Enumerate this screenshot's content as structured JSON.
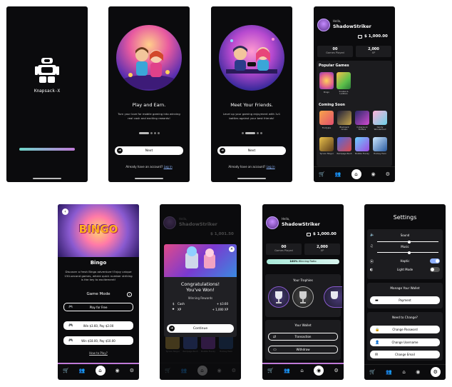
{
  "splash": {
    "brand": "Knapsack-X"
  },
  "onboard1": {
    "title": "Play and Earn.",
    "body": "Turn your love for mobile gaming into winning real cash and exciting rewards!",
    "next_label": "Next",
    "login_prompt": "Already have an account?",
    "login_link": "Log in"
  },
  "onboard2": {
    "title": "Meet Your Friends.",
    "body": "Level up your gaming enjoyment with 1v1 battles against your best friends!",
    "next_label": "Next",
    "login_prompt": "Already have an account?",
    "login_link": "Log in"
  },
  "home": {
    "greeting": "Hello,",
    "username": "ShadowStriker",
    "balance": "$ 1,000.00",
    "games_played_value": "00",
    "games_played_label": "Games Played",
    "xp_value": "2,000",
    "xp_label": "XP",
    "popular_title": "Popular Games",
    "popular": [
      "Bingo",
      "Snakes & Ladders"
    ],
    "coming_title": "Coming Soon",
    "coming": [
      "Fruityple",
      "Blackjack Crown",
      "Cyberpunk Drifters",
      "Candy Wonderland",
      "Tycoon Mogul",
      "Rampage Rush",
      "Bubble Frenzy",
      "Hockey Hero"
    ]
  },
  "bingo": {
    "logo_text": "BINGO",
    "title": "Bingo",
    "body": "Discover a fresh Bingo adventure! Enjoy unique 150-second games, where quick number striking is the key to excitement!",
    "mode_title": "Game Mode",
    "info_glyph": "i",
    "free_label": "Play for Free",
    "paid1_label": "Win $3.60, Pay $2.00",
    "paid2_label": "Win $18.00, Pay $10.00",
    "howto_label": "How to Play?"
  },
  "win": {
    "greeting": "Hello,",
    "username": "ShadowStriker",
    "balance": "$ 1,001.50",
    "title_line1": "Congratulations!",
    "title_line2": "You've Won!",
    "rewards_title": "Winning Rewards",
    "cash_label": "Cash",
    "cash_value": "+ $3.60",
    "xp_label": "XP",
    "xp_value": "+ 1,000 XP",
    "continue_label": "Continue",
    "bg_tiles": [
      "Tycoon Mogul",
      "Rampage Rush",
      "Bubble Frenzy",
      "Hockey Hero"
    ]
  },
  "profile": {
    "greeting": "Hello,",
    "username": "ShadowStriker",
    "balance": "$ 1,000.00",
    "games_played_value": "00",
    "games_played_label": "Games Played",
    "xp_value": "2,000",
    "xp_label": "XP",
    "win_ratio_value": "100%",
    "win_ratio_label": "Winning Ratio",
    "trophies_title": "Your Trophies",
    "wallet_title": "Your Wallet",
    "transaction_label": "Transaction",
    "withdraw_label": "Withdraw"
  },
  "settings": {
    "title": "Settings",
    "sound_label": "Sound",
    "music_label": "Music",
    "haptic_label": "Haptic",
    "light_label": "Light Mode",
    "sound_level": 0.52,
    "music_level": 0.52,
    "haptic_on": true,
    "light_on": false,
    "wallet_title": "Manage Your Wallet",
    "payment_label": "Payment",
    "change_title": "Need to Change?",
    "change_password": "Change Password",
    "change_username": "Change Username",
    "change_email": "Change Email"
  },
  "nav": {
    "icons": [
      "cart-icon",
      "friends-icon",
      "home-icon",
      "profile-icon",
      "settings-icon"
    ]
  },
  "colors": {
    "accent": "#8fb0ff",
    "progress_start": "#6ed6c8",
    "progress_end": "#c07ad8",
    "gold": "#e8c04a"
  }
}
